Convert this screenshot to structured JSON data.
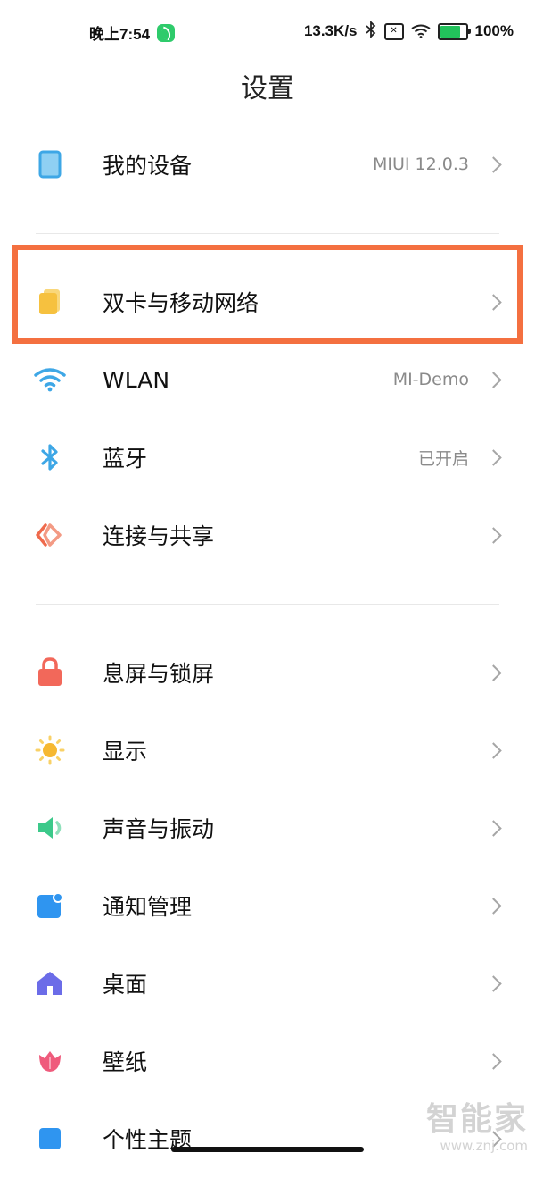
{
  "status_bar": {
    "time": "晚上7:54",
    "network_speed": "13.3K/s",
    "battery": "100%"
  },
  "header": {
    "title": "设置"
  },
  "rows": {
    "my_device": {
      "label": "我的设备",
      "value": "MIUI 12.0.3"
    },
    "dual_sim": {
      "label": "双卡与移动网络"
    },
    "wlan": {
      "label": "WLAN",
      "value": "MI-Demo"
    },
    "bluetooth": {
      "label": "蓝牙",
      "value": "已开启"
    },
    "connection": {
      "label": "连接与共享"
    },
    "lock_screen": {
      "label": "息屏与锁屏"
    },
    "display": {
      "label": "显示"
    },
    "sound": {
      "label": "声音与振动"
    },
    "notifications": {
      "label": "通知管理"
    },
    "desktop": {
      "label": "桌面"
    },
    "wallpaper": {
      "label": "壁纸"
    },
    "themes": {
      "label": "个性主题"
    }
  },
  "icons": {
    "my_device": "tablet-icon",
    "dual_sim": "sim-card-icon",
    "wlan": "wifi-icon",
    "bluetooth": "bluetooth-icon",
    "connection": "share-icon",
    "lock_screen": "lock-icon",
    "display": "sun-icon",
    "sound": "speaker-icon",
    "notifications": "notification-icon",
    "desktop": "home-icon",
    "wallpaper": "flower-icon"
  },
  "colors": {
    "highlight": "#f47040",
    "device": "#3ea7e6",
    "sim": "#f6c13f",
    "wifi": "#3ea7e6",
    "bluetooth": "#3ea7e6",
    "share": "#ef6a4c",
    "lock": "#f2685a",
    "sun": "#f6b832",
    "sound": "#3cc98a",
    "notify": "#2f95f0",
    "home": "#6b6ce8",
    "wallpaper": "#ef5b7c"
  },
  "watermark": {
    "brand": "智能家",
    "url": "www.znj.com"
  }
}
